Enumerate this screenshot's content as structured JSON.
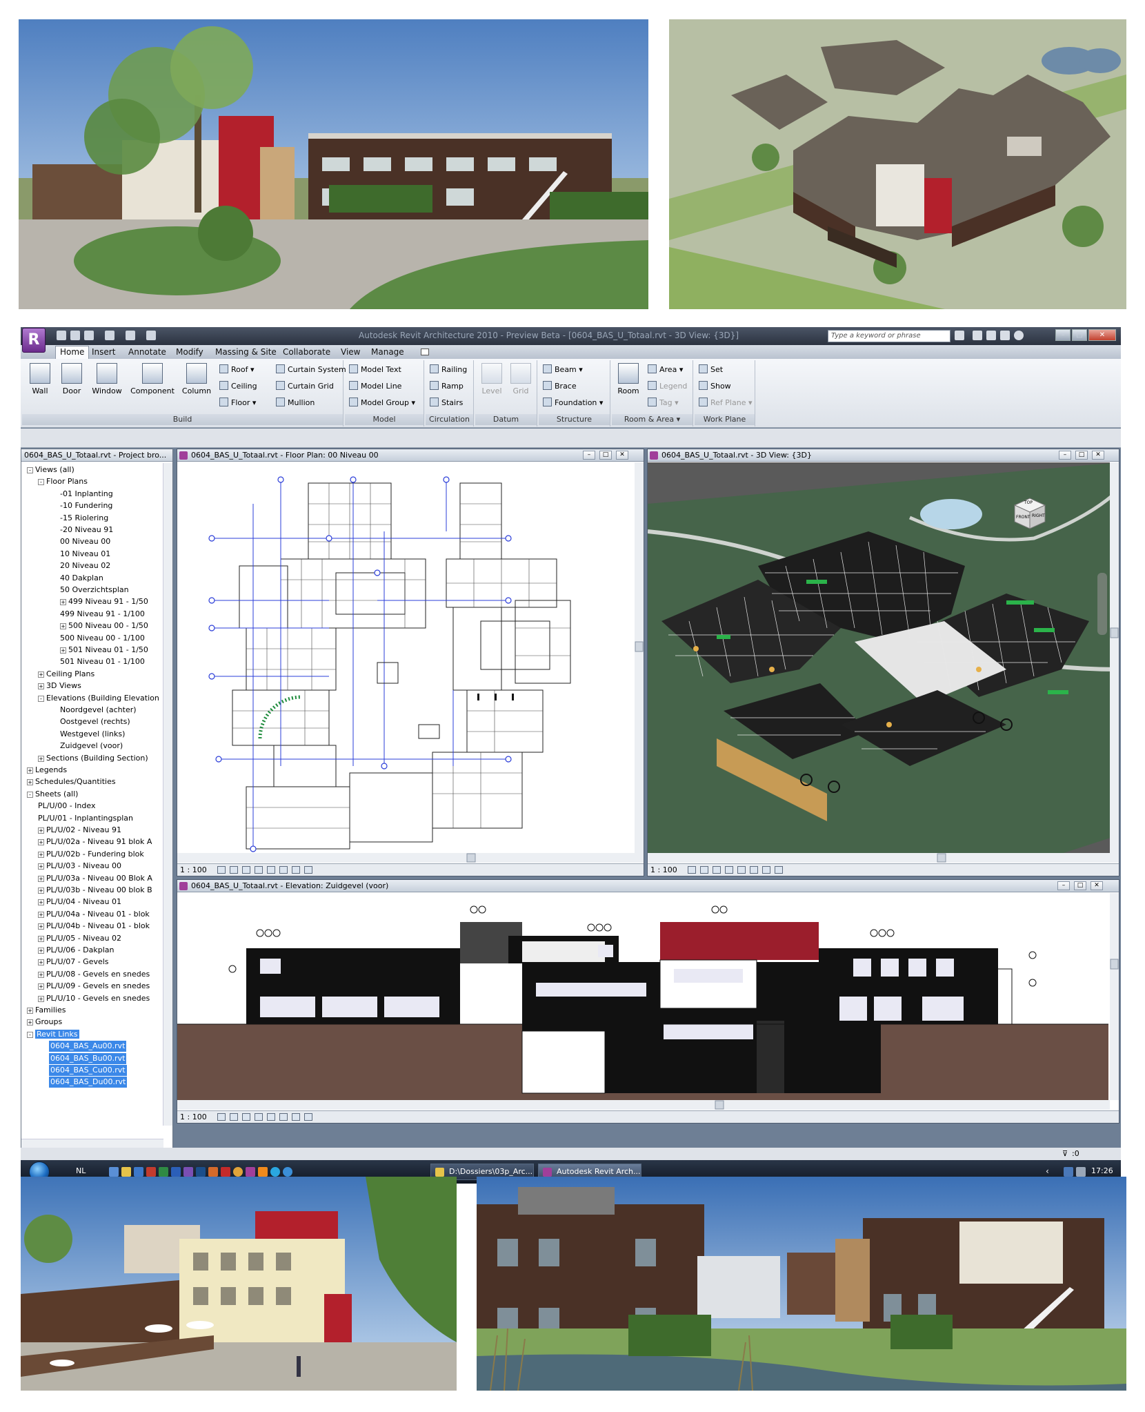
{
  "app": {
    "window_title": "Autodesk Revit Architecture 2010 - Preview Beta - [0604_BAS_U_Totaal.rvt - 3D View: {3D}]",
    "app_button_label": "R",
    "search_placeholder": "Type a keyword or phrase"
  },
  "ribbon": {
    "tabs": [
      "Home",
      "Insert",
      "Annotate",
      "Modify",
      "Massing & Site",
      "Collaborate",
      "View",
      "Manage"
    ],
    "active_tab": "Home",
    "panels": {
      "build": {
        "label": "Build",
        "big": [
          "Wall",
          "Door",
          "Window",
          "Component",
          "Column"
        ],
        "small": [
          "Roof",
          "Ceiling",
          "Floor",
          "Curtain System",
          "Curtain Grid",
          "Mullion"
        ]
      },
      "model": {
        "label": "Model",
        "small": [
          "Model Text",
          "Model Line",
          "Model Group"
        ]
      },
      "circulation": {
        "label": "Circulation",
        "small": [
          "Railing",
          "Ramp",
          "Stairs"
        ]
      },
      "datum": {
        "label": "Datum",
        "big": [
          "Level",
          "Grid"
        ]
      },
      "structure": {
        "label": "Structure",
        "small": [
          "Beam",
          "Brace",
          "Foundation"
        ]
      },
      "room_area": {
        "label": "Room & Area",
        "big": [
          "Room"
        ],
        "small": [
          "Area",
          "Legend",
          "Tag"
        ]
      },
      "work_plane": {
        "label": "Work Plane",
        "small": [
          "Set",
          "Show",
          "Ref Plane"
        ]
      }
    }
  },
  "browser": {
    "title": "0604_BAS_U_Totaal.rvt - Project bro...",
    "items": [
      {
        "label": "Views (all)",
        "indent": 0,
        "exp": "-"
      },
      {
        "label": "Floor Plans",
        "indent": 1,
        "exp": "-"
      },
      {
        "label": "-01 Inplanting",
        "indent": 3
      },
      {
        "label": "-10 Fundering",
        "indent": 3
      },
      {
        "label": "-15 Riolering",
        "indent": 3
      },
      {
        "label": "-20 Niveau 91",
        "indent": 3
      },
      {
        "label": "00 Niveau 00",
        "indent": 3
      },
      {
        "label": "10 Niveau 01",
        "indent": 3
      },
      {
        "label": "20 Niveau 02",
        "indent": 3
      },
      {
        "label": "40 Dakplan",
        "indent": 3
      },
      {
        "label": "50 Overzichtsplan",
        "indent": 3
      },
      {
        "label": "499 Niveau 91 - 1/50",
        "indent": 3,
        "exp": "+"
      },
      {
        "label": "499 Niveau 91 - 1/100",
        "indent": 3
      },
      {
        "label": "500 Niveau 00 - 1/50",
        "indent": 3,
        "exp": "+"
      },
      {
        "label": "500 Niveau 00 - 1/100",
        "indent": 3
      },
      {
        "label": "501 Niveau 01 - 1/50",
        "indent": 3,
        "exp": "+"
      },
      {
        "label": "501 Niveau 01 - 1/100",
        "indent": 3
      },
      {
        "label": "Ceiling Plans",
        "indent": 1,
        "exp": "+"
      },
      {
        "label": "3D Views",
        "indent": 1,
        "exp": "+"
      },
      {
        "label": "Elevations (Building Elevation",
        "indent": 1,
        "exp": "-"
      },
      {
        "label": "Noordgevel (achter)",
        "indent": 3
      },
      {
        "label": "Oostgevel (rechts)",
        "indent": 3
      },
      {
        "label": "Westgevel (links)",
        "indent": 3
      },
      {
        "label": "Zuidgevel (voor)",
        "indent": 3
      },
      {
        "label": "Sections (Building Section)",
        "indent": 1,
        "exp": "+"
      },
      {
        "label": "Legends",
        "indent": 0,
        "exp": "+"
      },
      {
        "label": "Schedules/Quantities",
        "indent": 0,
        "exp": "+"
      },
      {
        "label": "Sheets (all)",
        "indent": 0,
        "exp": "-"
      },
      {
        "label": "PL/U/00 - Index",
        "indent": 1
      },
      {
        "label": "PL/U/01 - Inplantingsplan",
        "indent": 1
      },
      {
        "label": "PL/U/02 - Niveau 91",
        "indent": 1,
        "exp": "+"
      },
      {
        "label": "PL/U/02a - Niveau 91 blok A",
        "indent": 1,
        "exp": "+"
      },
      {
        "label": "PL/U/02b - Fundering  blok",
        "indent": 1,
        "exp": "+"
      },
      {
        "label": "PL/U/03 - Niveau 00",
        "indent": 1,
        "exp": "+"
      },
      {
        "label": "PL/U/03a - Niveau 00 Blok A",
        "indent": 1,
        "exp": "+"
      },
      {
        "label": "PL/U/03b - Niveau 00 blok B",
        "indent": 1,
        "exp": "+"
      },
      {
        "label": "PL/U/04 - Niveau 01",
        "indent": 1,
        "exp": "+"
      },
      {
        "label": "PL/U/04a - Niveau 01 - blok",
        "indent": 1,
        "exp": "+"
      },
      {
        "label": "PL/U/04b - Niveau 01 - blok",
        "indent": 1,
        "exp": "+"
      },
      {
        "label": "PL/U/05 - Niveau 02",
        "indent": 1,
        "exp": "+"
      },
      {
        "label": "PL/U/06 - Dakplan",
        "indent": 1,
        "exp": "+"
      },
      {
        "label": "PL/U/07 - Gevels",
        "indent": 1,
        "exp": "+"
      },
      {
        "label": "PL/U/08 - Gevels en snedes",
        "indent": 1,
        "exp": "+"
      },
      {
        "label": "PL/U/09 - Gevels en snedes",
        "indent": 1,
        "exp": "+"
      },
      {
        "label": "PL/U/10 - Gevels en snedes",
        "indent": 1,
        "exp": "+"
      },
      {
        "label": "Families",
        "indent": 0,
        "exp": "+"
      },
      {
        "label": "Groups",
        "indent": 0,
        "exp": "+"
      },
      {
        "label": "Revit Links",
        "indent": 0,
        "exp": "-",
        "selected": true
      },
      {
        "label": "0604_BAS_Au00.rvt",
        "indent": 2,
        "selected": true
      },
      {
        "label": "0604_BAS_Bu00.rvt",
        "indent": 2,
        "selected": true
      },
      {
        "label": "0604_BAS_Cu00.rvt",
        "indent": 2,
        "selected": true
      },
      {
        "label": "0604_BAS_Du00.rvt",
        "indent": 2,
        "selected": true
      }
    ]
  },
  "views": {
    "floor_plan": {
      "title": "0604_BAS_U_Totaal.rvt - Floor Plan: 00 Niveau 00",
      "scale": "1 : 100"
    },
    "view_3d": {
      "title": "0604_BAS_U_Totaal.rvt - 3D View: {3D}",
      "scale": "1 : 100",
      "cube_top": "TOP",
      "cube_front": "FRONT",
      "cube_right": "RIGHT"
    },
    "elevation": {
      "title": "0604_BAS_U_Totaal.rvt - Elevation: Zuidgevel (voor)",
      "scale": "1 : 100"
    }
  },
  "status": {
    "filter": ":0"
  },
  "taskbar": {
    "language": "NL",
    "buttons": [
      "D:\\Dossiers\\03p_Arc...",
      "Autodesk Revit Arch..."
    ],
    "clock": "17:26"
  },
  "colors": {
    "accent_red": "#b3202c",
    "brick_brown": "#4a3126",
    "selection_blue": "#3b88e8",
    "grass": "#5c8a45"
  }
}
